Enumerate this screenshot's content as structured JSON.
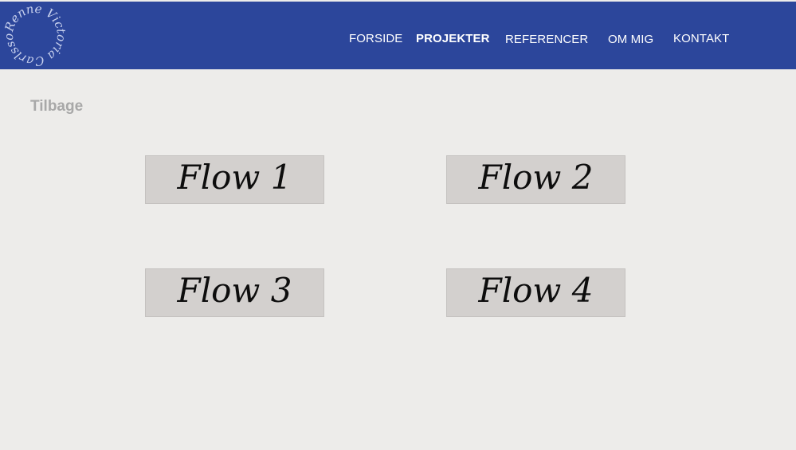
{
  "header": {
    "brand_color": "#2c469b",
    "logo": {
      "text": "Renne Victoria Carlsson"
    },
    "nav": [
      {
        "label": "FORSIDE",
        "active": false
      },
      {
        "label": "PROJEKTER",
        "active": true
      },
      {
        "label": "REFERENCER",
        "active": false
      },
      {
        "label": "OM MIG",
        "active": false
      },
      {
        "label": "KONTAKT",
        "active": false
      }
    ]
  },
  "main": {
    "back_label": "Tilbage",
    "flows": [
      {
        "label": "Flow 1"
      },
      {
        "label": "Flow 2"
      },
      {
        "label": "Flow 3"
      },
      {
        "label": "Flow 4"
      }
    ]
  },
  "colors": {
    "page_background": "#edecea",
    "button_background": "#d3d0ce",
    "back_link": "#a8a8a8"
  }
}
